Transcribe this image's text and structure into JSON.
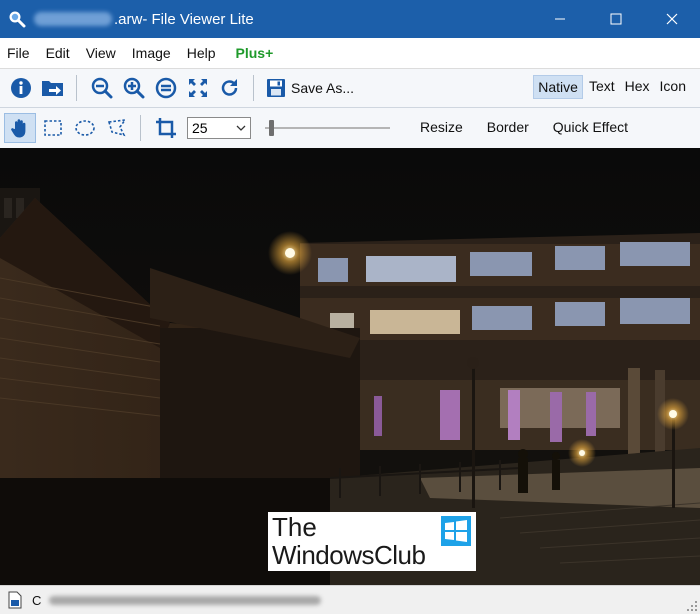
{
  "window": {
    "title_suffix": ".arw- File Viewer Lite"
  },
  "menu": {
    "items": [
      "File",
      "Edit",
      "View",
      "Image",
      "Help"
    ],
    "plus": "Plus+"
  },
  "toolbar": {
    "save_as_label": "Save As...",
    "view_tabs": [
      "Native",
      "Text",
      "Hex",
      "Icon"
    ],
    "active_view": "Native",
    "icons": [
      "info-icon",
      "open-folder-icon",
      "zoom-out-icon",
      "zoom-in-icon",
      "actual-size-icon",
      "fit-to-window-icon",
      "rotate-icon",
      "save-icon"
    ]
  },
  "image_toolbar": {
    "tools": [
      "pan-hand-icon",
      "rect-select-icon",
      "ellipse-select-icon",
      "lasso-select-icon",
      "crop-icon"
    ],
    "zoom_value": "25",
    "actions": [
      "Resize",
      "Border",
      "Quick Effect"
    ]
  },
  "watermark": {
    "line1": "The",
    "line2": "WindowsClub"
  },
  "statusbar": {
    "path_prefix": "C"
  },
  "colors": {
    "titlebar": "#1c5faa",
    "accent": "#1a5aa8",
    "plus": "#1f9a2b",
    "active_tab": "#cfe0f3"
  }
}
